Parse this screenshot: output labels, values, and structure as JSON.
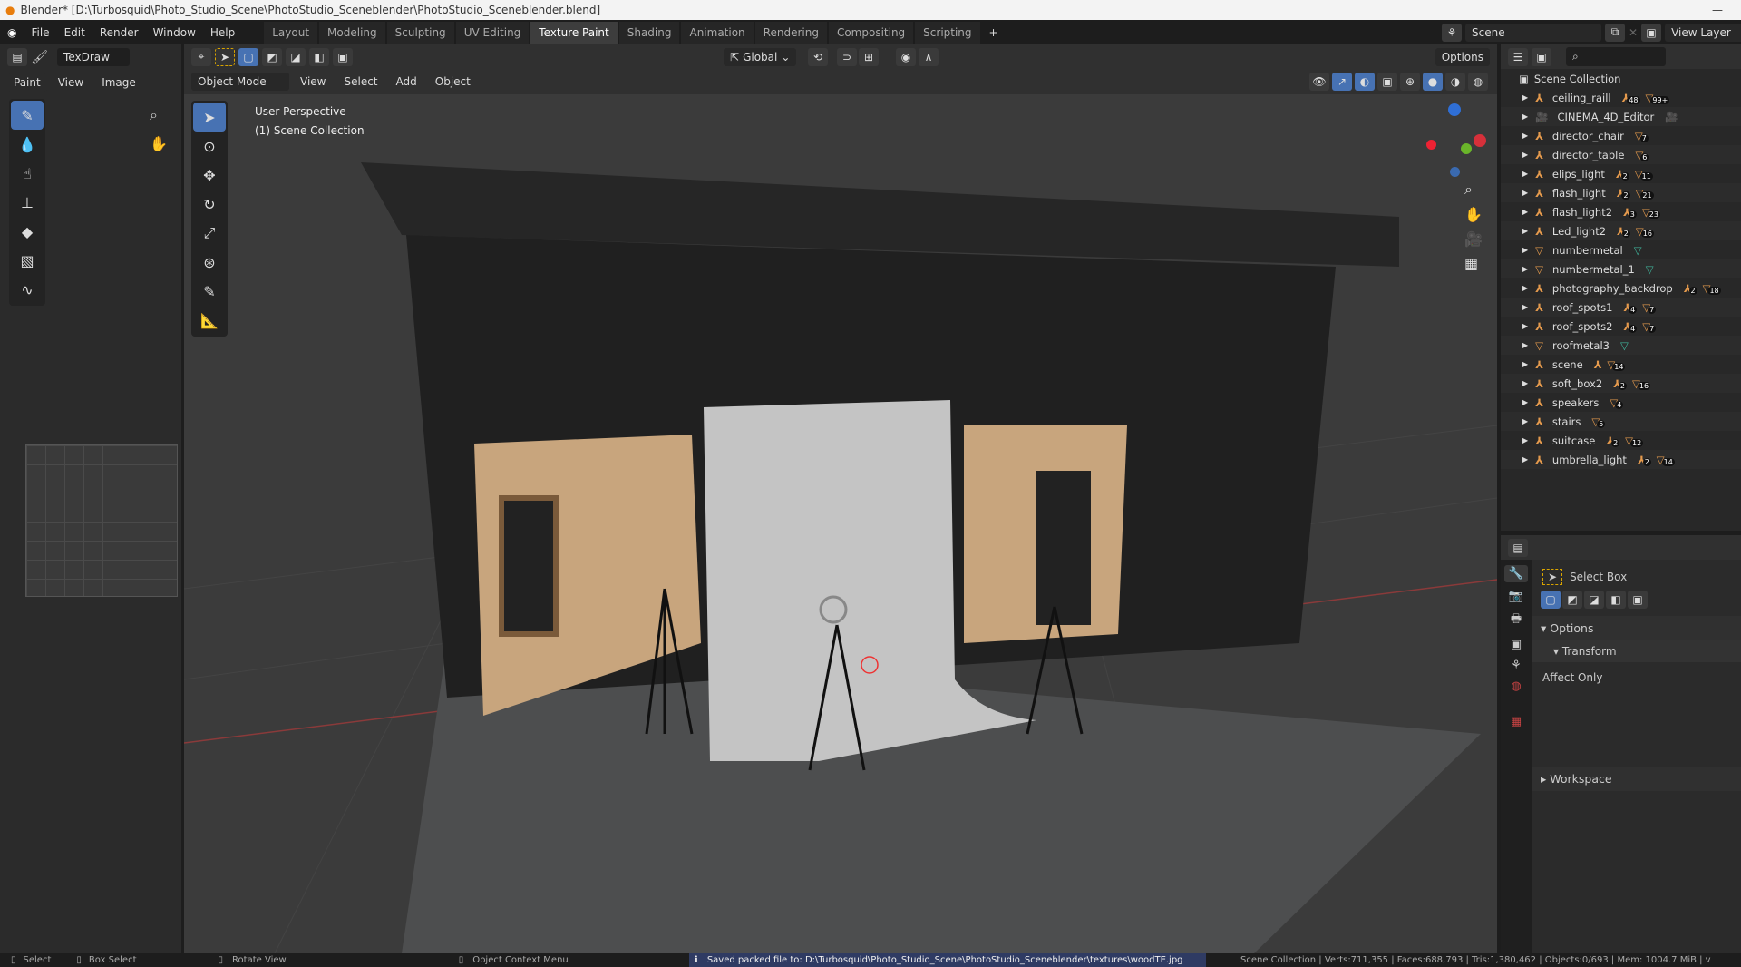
{
  "title": "Blender* [D:\\Turbosquid\\Photo_Studio_Scene\\PhotoStudio_Sceneblender\\PhotoStudio_Sceneblender.blend]",
  "menus": [
    "File",
    "Edit",
    "Render",
    "Window",
    "Help"
  ],
  "workspaces": [
    {
      "label": "Layout"
    },
    {
      "label": "Modeling"
    },
    {
      "label": "Sculpting"
    },
    {
      "label": "UV Editing"
    },
    {
      "label": "Texture Paint",
      "active": true
    },
    {
      "label": "Shading"
    },
    {
      "label": "Animation"
    },
    {
      "label": "Rendering"
    },
    {
      "label": "Compositing"
    },
    {
      "label": "Scripting"
    }
  ],
  "add_workspace": "+",
  "scene": {
    "name": "Scene",
    "view_layer": "View Layer"
  },
  "image_editor": {
    "brush": "TexDraw",
    "mode": "Paint",
    "menus": [
      "View",
      "Image"
    ]
  },
  "viewport": {
    "mode": "Object Mode",
    "menus": [
      "View",
      "Select",
      "Add",
      "Object"
    ],
    "orientation": "Global",
    "options": "Options",
    "perspective": "User Perspective",
    "collection": "(1) Scene Collection"
  },
  "outliner": {
    "root": "Scene Collection",
    "items": [
      {
        "name": "ceiling_raill",
        "icon": "empty",
        "badges": [
          "48",
          "99+"
        ]
      },
      {
        "name": "CINEMA_4D_Editor",
        "icon": "camera",
        "badges": []
      },
      {
        "name": "director_chair",
        "icon": "empty",
        "badges": [
          "7"
        ]
      },
      {
        "name": "director_table",
        "icon": "empty",
        "badges": [
          "6"
        ]
      },
      {
        "name": "elips_light",
        "icon": "empty",
        "badges": [
          "2",
          "11"
        ]
      },
      {
        "name": "flash_light",
        "icon": "empty",
        "badges": [
          "2",
          "21"
        ]
      },
      {
        "name": "flash_light2",
        "icon": "empty",
        "badges": [
          "3",
          "23"
        ]
      },
      {
        "name": "Led_light2",
        "icon": "empty",
        "badges": [
          "2",
          "16"
        ]
      },
      {
        "name": "numbermetal",
        "icon": "mesh",
        "badges": []
      },
      {
        "name": "numbermetal_1",
        "icon": "mesh",
        "badges": []
      },
      {
        "name": "photography_backdrop",
        "icon": "empty",
        "badges": [
          "2",
          "18"
        ]
      },
      {
        "name": "roof_spots1",
        "icon": "empty",
        "badges": [
          "4",
          "7"
        ]
      },
      {
        "name": "roof_spots2",
        "icon": "empty",
        "badges": [
          "4",
          "7"
        ]
      },
      {
        "name": "roofmetal3",
        "icon": "mesh",
        "badges": []
      },
      {
        "name": "scene",
        "icon": "empty",
        "badges": [
          "",
          "14"
        ]
      },
      {
        "name": "soft_box2",
        "icon": "empty",
        "badges": [
          "2",
          "16"
        ]
      },
      {
        "name": "speakers",
        "icon": "empty",
        "badges": [
          "4"
        ]
      },
      {
        "name": "stairs",
        "icon": "empty",
        "badges": [
          "5"
        ]
      },
      {
        "name": "suitcase",
        "icon": "empty",
        "badges": [
          "2",
          "12"
        ]
      },
      {
        "name": "umbrella_light",
        "icon": "empty",
        "badges": [
          "2",
          "14"
        ]
      }
    ]
  },
  "properties": {
    "tool": "Select Box",
    "options": "Options",
    "transform": "Transform",
    "affect_only": "Affect Only",
    "workspace": "Workspace"
  },
  "status": {
    "select": "Select",
    "box_select": "Box Select",
    "rotate": "Rotate View",
    "context": "Object Context Menu",
    "message": "Saved packed file to: D:\\Turbosquid\\Photo_Studio_Scene\\PhotoStudio_Sceneblender\\textures\\woodTE.jpg",
    "stats": "Scene Collection | Verts:711,355 | Faces:688,793 | Tris:1,380,462 | Objects:0/693 | Mem: 1004.7 MiB | v"
  },
  "colors": {
    "accent": "#4772b3",
    "object_orange": "#e59a4d",
    "data_green": "#3fb39a"
  }
}
